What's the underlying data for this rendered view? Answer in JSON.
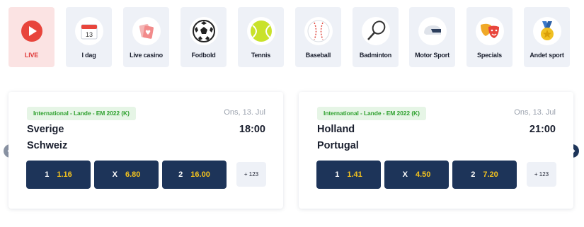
{
  "categories": [
    {
      "label": "LIVE",
      "icon": "live-play-icon",
      "active": true
    },
    {
      "label": "I dag",
      "icon": "calendar-icon",
      "calendar_day": "13"
    },
    {
      "label": "Live casino",
      "icon": "playing-cards-icon"
    },
    {
      "label": "Fodbold",
      "icon": "soccer-ball-icon"
    },
    {
      "label": "Tennis",
      "icon": "tennis-ball-icon"
    },
    {
      "label": "Baseball",
      "icon": "baseball-icon"
    },
    {
      "label": "Badminton",
      "icon": "badminton-racket-icon"
    },
    {
      "label": "Motor Sport",
      "icon": "racing-helmet-icon"
    },
    {
      "label": "Specials",
      "icon": "theatre-masks-icon"
    },
    {
      "label": "Andet sport",
      "icon": "medal-icon"
    }
  ],
  "matches": [
    {
      "league": "International - Lande - EM 2022 (K)",
      "date": "Ons, 13. Jul",
      "home": "Sverige",
      "away": "Schweiz",
      "time": "18:00",
      "odds": [
        {
          "label": "1",
          "value": "1.16"
        },
        {
          "label": "X",
          "value": "6.80"
        },
        {
          "label": "2",
          "value": "16.00"
        }
      ],
      "more": "+ 123"
    },
    {
      "league": "International - Lande - EM 2022 (K)",
      "date": "Ons, 13. Jul",
      "home": "Holland",
      "away": "Portugal",
      "time": "21:00",
      "odds": [
        {
          "label": "1",
          "value": "1.41"
        },
        {
          "label": "X",
          "value": "4.50"
        },
        {
          "label": "2",
          "value": "7.20"
        }
      ],
      "more": "+ 123"
    }
  ],
  "colors": {
    "navy": "#1d3459",
    "odds_value": "#f3c21e",
    "live_red": "#e03b3b",
    "league_green": "#2fa12f",
    "tile_bg": "#eef1f7"
  }
}
